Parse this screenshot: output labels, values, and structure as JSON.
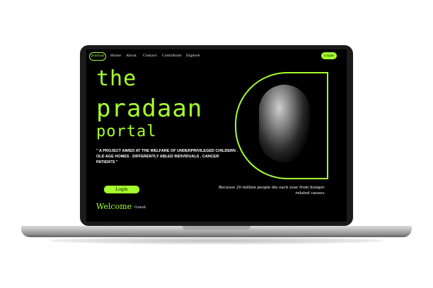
{
  "nav": {
    "brand": "pradaan",
    "links": [
      "Home",
      "About",
      "Contact",
      "Contribute",
      "Explore"
    ],
    "login": "Login"
  },
  "hero": {
    "title_line1": "the",
    "title_line2": "pradaan",
    "title_line3": "portal",
    "description": "\" A PROJECT AIMED AT THE WELFARE OF UNDERPRIVILEGED CHILDERN . OLD AGE HOMES . DIFFERENTLY ABLED INDIVIDUALS . CANCER PATIENTS \"",
    "quote": "Because 20 million people die each year from hunger-related causes.",
    "login_button": "Login",
    "welcome": "Welcome",
    "guest": "Guest"
  },
  "colors": {
    "accent": "#a6ff2d",
    "background": "#000000"
  },
  "icons": {
    "hero_image": "child-photo"
  }
}
